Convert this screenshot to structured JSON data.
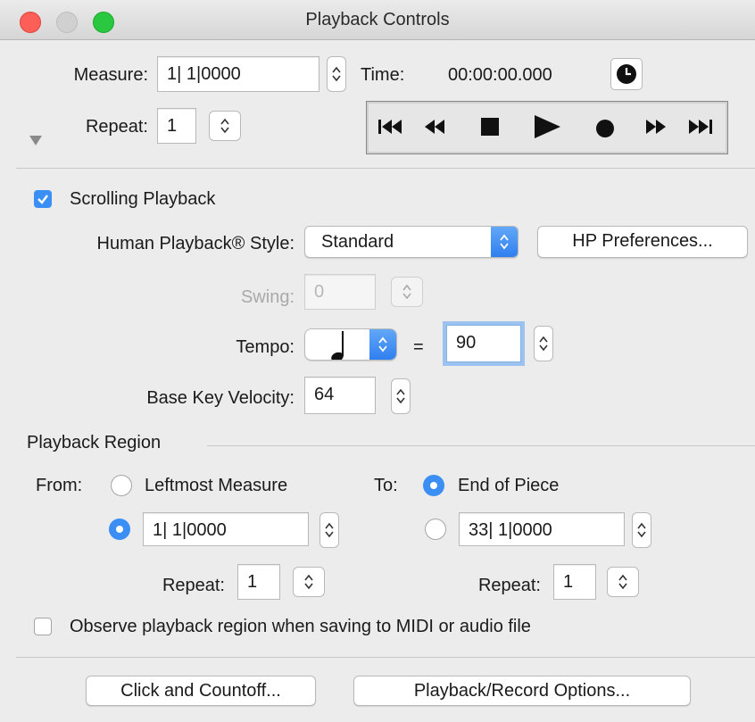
{
  "window": {
    "title": "Playback Controls"
  },
  "header": {
    "measure_label": "Measure:",
    "measure_value": "1| 1|0000",
    "time_label": "Time:",
    "time_value": "00:00:00.000",
    "repeat_label": "Repeat:",
    "repeat_value": "1"
  },
  "transport": [
    "skip-to-start-icon",
    "rewind-icon",
    "stop-icon",
    "play-icon",
    "record-icon",
    "fast-forward-icon",
    "skip-to-end-icon"
  ],
  "options": {
    "scrolling_label": "Scrolling Playback",
    "scrolling_checked": true,
    "hp_style_label": "Human Playback® Style:",
    "hp_style_value": "Standard",
    "hp_prefs_button": "HP Preferences...",
    "swing_label": "Swing:",
    "swing_value": "0",
    "tempo_label": "Tempo:",
    "tempo_equals": "=",
    "tempo_value": "90",
    "velocity_label": "Base Key Velocity:",
    "velocity_value": "64"
  },
  "region": {
    "section_label": "Playback Region",
    "from_label": "From:",
    "from_option_leftmost": "Leftmost Measure",
    "from_selected": "measure",
    "from_measure_value": "1| 1|0000",
    "from_repeat_label": "Repeat:",
    "from_repeat_value": "1",
    "to_label": "To:",
    "to_option_end": "End of Piece",
    "to_selected": "end",
    "to_measure_value": "33| 1|0000",
    "to_repeat_label": "Repeat:",
    "to_repeat_value": "1",
    "observe_label": "Observe playback region when saving to MIDI or audio file",
    "observe_checked": false
  },
  "footer": {
    "click_button": "Click and Countoff...",
    "options_button": "Playback/Record Options..."
  },
  "colors": {
    "accent": "#3b8ef3",
    "close": "#fc5f57",
    "minimize_inactive": "#d0d0d0",
    "zoom": "#29c840"
  }
}
